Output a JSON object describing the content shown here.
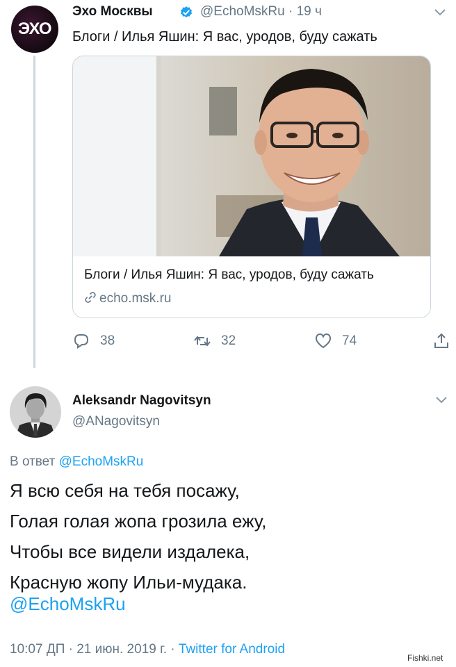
{
  "tweet1": {
    "author_name": "Эхо Москвы",
    "handle": "@EchoMskRu",
    "time": "· 19 ч",
    "text": "Блоги / Илья Яшин: Я вас, уродов, буду сажать",
    "avatar_logo_text": "ЭХО",
    "card": {
      "title": "Блоги / Илья Яшин: Я вас, уродов, буду сажать",
      "domain": "echo.msk.ru"
    },
    "actions": {
      "replies": "38",
      "retweets": "32",
      "likes": "74"
    }
  },
  "tweet2": {
    "author_name": "Aleksandr Nagovitsyn",
    "handle": "@ANagovitsyn",
    "reply_prefix": "В ответ",
    "reply_mention": "@EchoMskRu",
    "lines": [
      "Я всю себя на тебя посажу,",
      "Голая голая жопа грозила ежу,",
      "Чтобы все видели издалека,",
      "Красную жопу Ильи-мудака."
    ],
    "mention": "@EchoMskRu",
    "timestamp": "10:07 ДП · 21 июн. 2019 г. ·",
    "source": "Twitter for Android"
  },
  "watermark": "Fishki.net",
  "colors": {
    "link": "#1da1f2",
    "muted": "#657786",
    "verified": "#1da1f2"
  }
}
